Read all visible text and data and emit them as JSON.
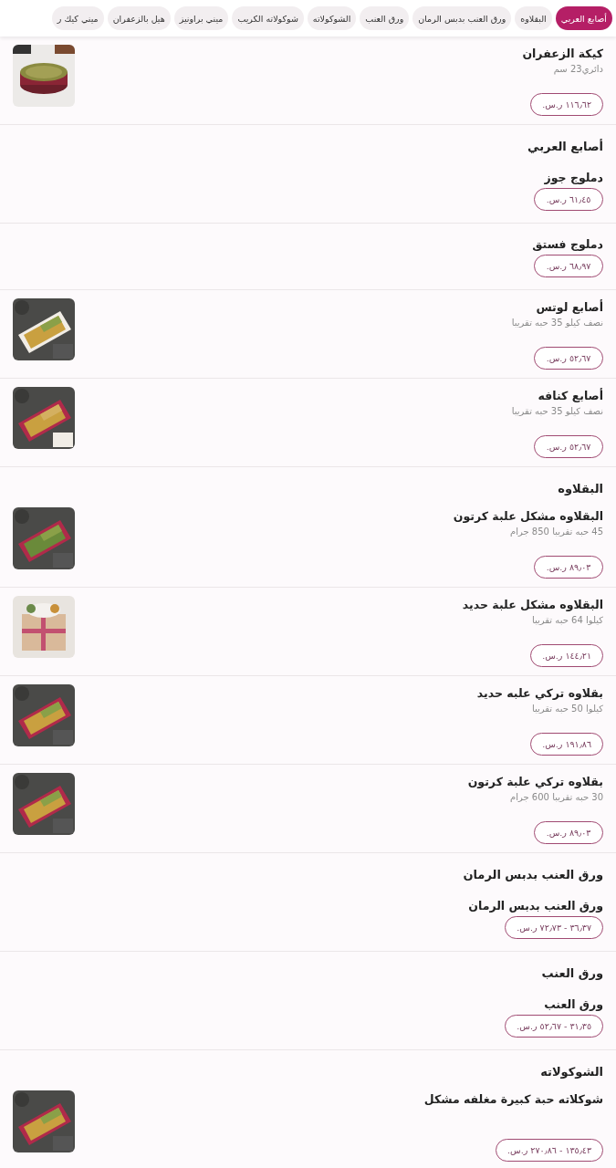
{
  "tabs": [
    {
      "label": "أصابع العربي",
      "selected": true
    },
    {
      "label": "البقلاوه",
      "selected": false
    },
    {
      "label": "ورق العنب بدبس الرمان",
      "selected": false
    },
    {
      "label": "ورق العنب",
      "selected": false
    },
    {
      "label": "الشوكولاته",
      "selected": false
    },
    {
      "label": "شوكولاته الكريب",
      "selected": false
    },
    {
      "label": "ميني براونيز",
      "selected": false
    },
    {
      "label": "هيل بالزعفران",
      "selected": false
    },
    {
      "label": "ميني كيك ر",
      "selected": false
    }
  ],
  "sections": [
    {
      "items": [
        {
          "name": "كيكة الزعفران",
          "description": "دائري23 سم",
          "price": "١١٦٫٦٢ ر.س.",
          "picture": true
        }
      ]
    },
    {
      "title": "أصابع العربي",
      "items": [
        {
          "name": "دملوج جوز",
          "price": "٦١٫٤٥ ر.س.",
          "picture": false
        },
        {
          "name": "دملوج فستق",
          "price": "٦٨٫٩٧ ر.س.",
          "picture": false
        },
        {
          "name": "أصابع لوتس",
          "description": "نصف كيلو 35 حبه تقريبا",
          "price": "٥٢٫٦٧ ر.س.",
          "picture": true
        },
        {
          "name": "أصابع كنافه",
          "description": "نصف كيلو 35 حبه تقريبا",
          "price": "٥٢٫٦٧ ر.س.",
          "picture": true
        }
      ]
    },
    {
      "title": "البقلاوه",
      "items": [
        {
          "name": "البقلاوه مشكل علبة كرتون",
          "description": "45 حبه تقريبا 850 جرام",
          "price": "٨٩٫٠٣ ر.س.",
          "picture": true
        },
        {
          "name": "البقلاوه مشكل علبة حديد",
          "description": "كيلوا 64 حبه تقريبا",
          "price": "١٤٤٫٢١ ر.س.",
          "picture": true
        },
        {
          "name": "بقلاوه تركي علبه حديد",
          "description": "كيلوا 50 حبه تقريبا",
          "price": "١٩١٫٨٦ ر.س.",
          "picture": true
        },
        {
          "name": "بقلاوه تركي علبة كرتون",
          "description": "30 حبه تقريبا 600 جرام",
          "price": "٨٩٫٠٣ ر.س.",
          "picture": true
        }
      ]
    },
    {
      "title": "ورق العنب بدبس الرمان",
      "items": [
        {
          "name": "ورق العنب بدبس الرمان",
          "price": "٣٦٫٣٧ - ٧٢٫٧٣ ر.س.",
          "picture": false
        }
      ]
    },
    {
      "title": "ورق العنب",
      "items": [
        {
          "name": "ورق العنب",
          "price": "٣١٫٣٥ - ٥٢٫٦٧ ر.س.",
          "picture": false
        }
      ]
    },
    {
      "title": "الشوكولاته",
      "items": [
        {
          "name": "شوكلاته حبة كبيرة مغلفه مشكل",
          "price": "١٣٥٫٤٣ - ٢٧٠٫٨٦ ر.س.",
          "picture": true
        }
      ]
    }
  ]
}
